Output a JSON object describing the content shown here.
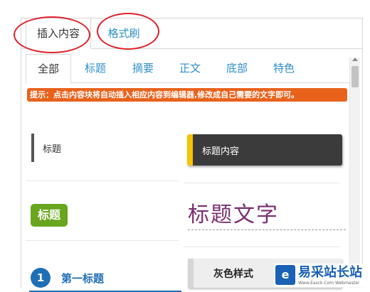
{
  "tabs": [
    {
      "label": "插入内容",
      "active": true
    },
    {
      "label": "格式刷",
      "active": false
    }
  ],
  "categories": [
    {
      "label": "全部",
      "active": true
    },
    {
      "label": "标题"
    },
    {
      "label": "摘要"
    },
    {
      "label": "正文"
    },
    {
      "label": "底部"
    },
    {
      "label": "特色"
    }
  ],
  "hint": "提示：点击内容块将自动插入相应内容到编辑器,修改成自己需要的文字即可。",
  "blocks": {
    "b1": "标题",
    "b2": "标题内容",
    "b3": "标题",
    "b4": "标题文字",
    "b5_num": "1",
    "b5_text": "第一标题",
    "b6": "灰色样式"
  },
  "watermark": {
    "name": "易采站长站",
    "sub": "Www.Easck.Com Webmaster"
  },
  "colors": {
    "accent_blue": "#2f8fc6",
    "hint_orange": "#e8621c",
    "green": "#6aa51e",
    "purple": "#7b2e6f",
    "annotation_red": "#e0212b"
  }
}
